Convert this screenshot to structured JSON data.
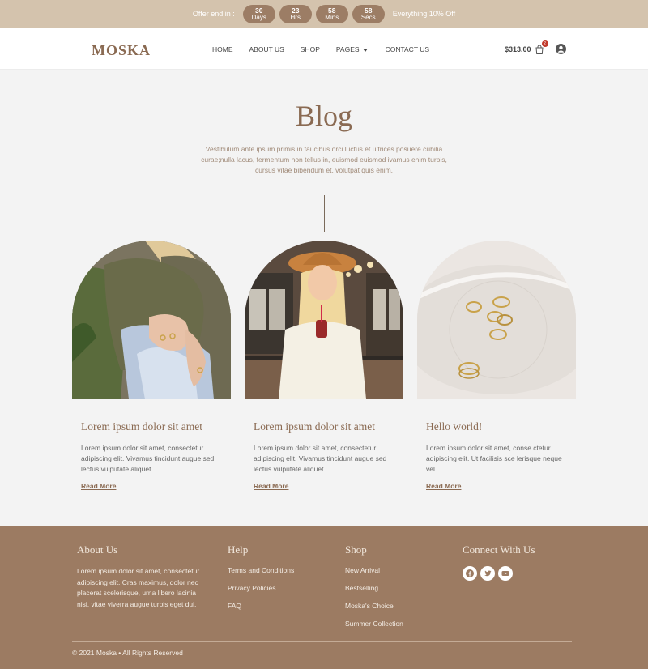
{
  "topbar": {
    "offer_label": "Offer end in :",
    "countdown": [
      {
        "value": "30",
        "unit": "Days"
      },
      {
        "value": "23",
        "unit": "Hrs"
      },
      {
        "value": "58",
        "unit": "Mins"
      },
      {
        "value": "58",
        "unit": "Secs"
      }
    ],
    "promo": "Everything 10% Off"
  },
  "header": {
    "logo": "MOSKA",
    "nav": [
      "HOME",
      "ABOUT US",
      "SHOP",
      "PAGES",
      "CONTACT US"
    ],
    "cart_total": "$313.00",
    "cart_count": "2",
    "icons": [
      "cart-icon",
      "user-icon",
      "chevron-down-icon"
    ]
  },
  "hero": {
    "title": "Blog",
    "description": "Vestibulum ante ipsum primis in faucibus orci luctus et ultrices posuere cubilia curae;nulla lacus, fermentum non tellus in, euismod euismod ivamus enim turpis, cursus vitae bibendum et, volutpat quis enim."
  },
  "posts": [
    {
      "title": "Lorem ipsum dolor sit amet",
      "excerpt": "Lorem ipsum dolor sit amet, consectetur adipiscing elit. Vivamus tincidunt augue sed lectus vulputate aliquet.",
      "link": "Read More",
      "image": "woman-knit-sweater-rings-photo"
    },
    {
      "title": "Lorem ipsum dolor sit amet",
      "excerpt": "Lorem ipsum dolor sit amet, consectetur adipiscing elit. Vivamus tincidunt augue sed lectus vulputate aliquet.",
      "link": "Read More",
      "image": "woman-hat-drink-photo"
    },
    {
      "title": "Hello world!",
      "excerpt": "Lorem ipsum dolor sit amet, conse ctetur adipiscing elit. Ut facilisis sce lerisque neque vel",
      "link": "Read More",
      "image": "gold-rings-on-glass-photo"
    }
  ],
  "footer": {
    "about": {
      "title": "About Us",
      "text": "Lorem ipsum dolor sit amet, consectetur adipiscing elit. Cras maximus, dolor nec placerat scelerisque, urna libero lacinia nisi, vitae viverra augue turpis eget dui."
    },
    "help": {
      "title": "Help",
      "links": [
        "Terms and Conditions",
        "Privacy Policies",
        "FAQ"
      ]
    },
    "shop": {
      "title": "Shop",
      "links": [
        "New Arrival",
        "Bestselling",
        "Moska's Choice",
        "Summer Collection"
      ]
    },
    "connect": {
      "title": "Connect With Us",
      "icons": [
        "facebook-icon",
        "twitter-icon",
        "youtube-icon"
      ]
    },
    "copyright": "© 2021 Moska • All Rights Reserved"
  },
  "colors": {
    "topbar_bg": "#d4c3ad",
    "pill_bg": "#9c7d65",
    "brand": "#8a6a52",
    "footer_bg": "#9c7b62",
    "badge": "#c0392b"
  }
}
